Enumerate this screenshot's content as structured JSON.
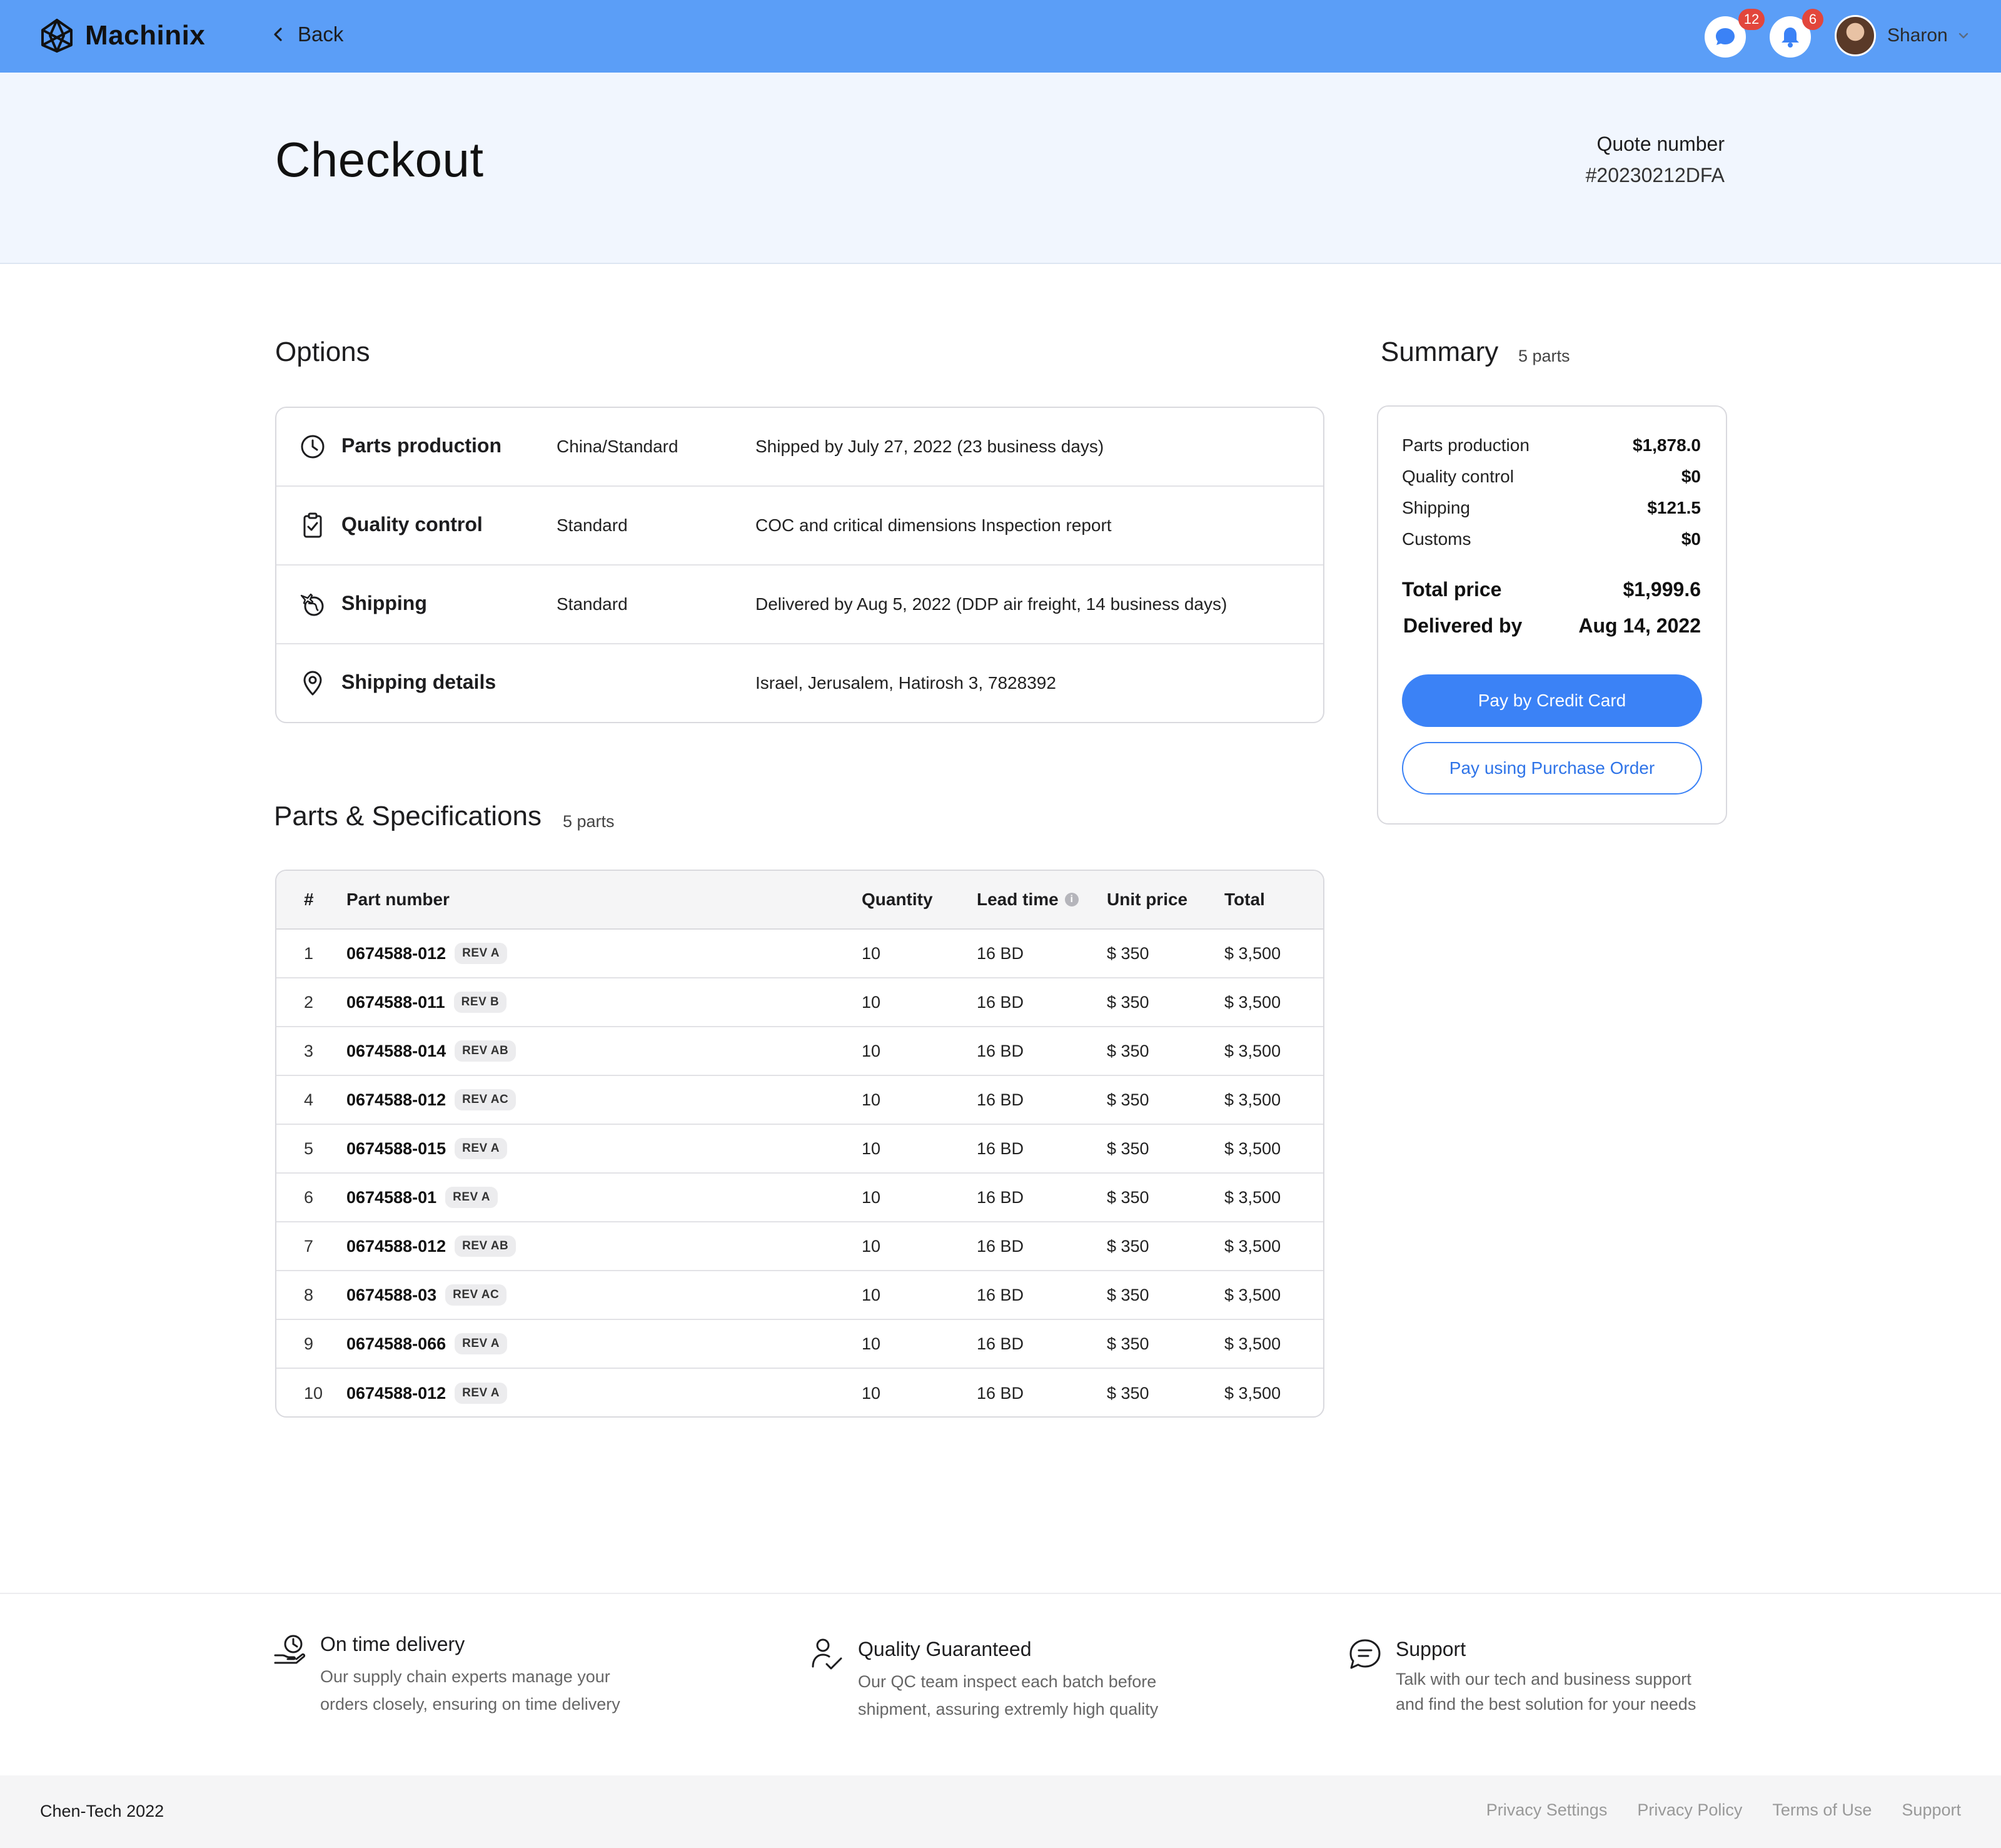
{
  "app": {
    "name": "Machinix"
  },
  "nav": {
    "back_label": "Back",
    "messages_count": "12",
    "notifications_count": "6",
    "user_name": "Sharon"
  },
  "header": {
    "title": "Checkout",
    "quote_label": "Quote number",
    "quote_number": "#20230212DFA"
  },
  "options": {
    "heading": "Options",
    "rows": [
      {
        "label": "Parts production",
        "type": "China/Standard",
        "desc": "Shipped by July 27, 2022 (23 business days)",
        "icon": "clock-icon"
      },
      {
        "label": "Quality control",
        "type": "Standard",
        "desc": "COC and critical dimensions Inspection report",
        "icon": "clipboard-check-icon"
      },
      {
        "label": "Shipping",
        "type": "Standard",
        "desc": "Delivered by Aug 5, 2022 (DDP air freight, 14 business days)",
        "icon": "plane-globe-icon"
      },
      {
        "label": "Shipping details",
        "type": "",
        "desc": "Israel, Jerusalem, Hatirosh 3, 7828392",
        "icon": "location-pin-icon"
      }
    ]
  },
  "summary": {
    "heading": "Summary",
    "count": "5 parts",
    "lines": [
      {
        "label": "Parts production",
        "value": "$1,878.0"
      },
      {
        "label": "Quality control",
        "value": "$0"
      },
      {
        "label": "Shipping",
        "value": "$121.5"
      },
      {
        "label": "Customs",
        "value": "$0"
      }
    ],
    "total_label": "Total price",
    "total_value": "$1,999.6",
    "delivered_label": "Delivered by",
    "delivered_value": "Aug 14, 2022",
    "pay_card_label": "Pay by Credit Card",
    "pay_po_label": "Pay using Purchase Order"
  },
  "parts": {
    "heading": "Parts & Specifications",
    "count": "5 parts",
    "columns": {
      "idx": "#",
      "part": "Part number",
      "qty": "Quantity",
      "lead": "Lead time",
      "unit": "Unit price",
      "total": "Total"
    },
    "rows": [
      {
        "idx": "1",
        "part": "0674588-012",
        "rev": "REV A",
        "qty": "10",
        "lead": "16 BD",
        "unit": "$ 350",
        "total": "$ 3,500"
      },
      {
        "idx": "2",
        "part": "0674588-011",
        "rev": "REV B",
        "qty": "10",
        "lead": "16 BD",
        "unit": "$ 350",
        "total": "$ 3,500"
      },
      {
        "idx": "3",
        "part": "0674588-014",
        "rev": "REV AB",
        "qty": "10",
        "lead": "16 BD",
        "unit": "$ 350",
        "total": "$ 3,500"
      },
      {
        "idx": "4",
        "part": "0674588-012",
        "rev": "REV AC",
        "qty": "10",
        "lead": "16 BD",
        "unit": "$ 350",
        "total": "$ 3,500"
      },
      {
        "idx": "5",
        "part": "0674588-015",
        "rev": "REV A",
        "qty": "10",
        "lead": "16 BD",
        "unit": "$ 350",
        "total": "$ 3,500"
      },
      {
        "idx": "6",
        "part": "0674588-01",
        "rev": "REV A",
        "qty": "10",
        "lead": "16 BD",
        "unit": "$ 350",
        "total": "$ 3,500"
      },
      {
        "idx": "7",
        "part": "0674588-012",
        "rev": "REV AB",
        "qty": "10",
        "lead": "16 BD",
        "unit": "$ 350",
        "total": "$ 3,500"
      },
      {
        "idx": "8",
        "part": "0674588-03",
        "rev": "REV AC",
        "qty": "10",
        "lead": "16 BD",
        "unit": "$ 350",
        "total": "$ 3,500"
      },
      {
        "idx": "9",
        "part": "0674588-066",
        "rev": "REV A",
        "qty": "10",
        "lead": "16 BD",
        "unit": "$ 350",
        "total": "$ 3,500"
      },
      {
        "idx": "10",
        "part": "0674588-012",
        "rev": "REV A",
        "qty": "10",
        "lead": "16 BD",
        "unit": "$ 350",
        "total": "$ 3,500"
      }
    ]
  },
  "features": [
    {
      "title": "On time delivery",
      "line1": "Our supply chain experts manage your",
      "line2": "orders closely, ensuring on time delivery"
    },
    {
      "title": "Quality Guaranteed",
      "line1": "Our QC team inspect each batch before",
      "line2": "shipment, assuring extremly high quality"
    },
    {
      "title": "Support",
      "line1": "Talk with our tech and business support",
      "line2": "and find the best solution for your needs"
    }
  ],
  "footer": {
    "copyright": "Chen-Tech 2022",
    "links": [
      "Privacy Settings",
      "Privacy Policy",
      "Terms of Use",
      "Support"
    ]
  },
  "colors": {
    "topbar": "#5b9ef7",
    "accent": "#3b82f6",
    "badge": "#e2463c",
    "band": "#f1f6fe"
  }
}
